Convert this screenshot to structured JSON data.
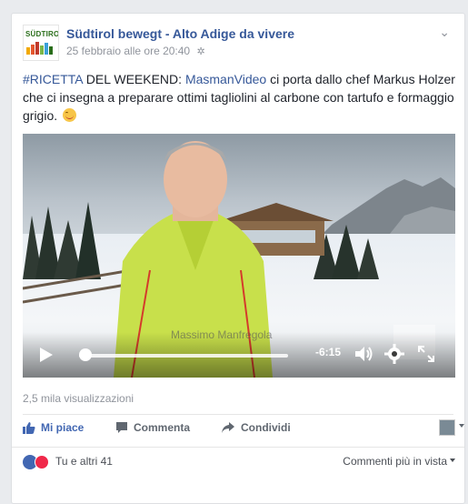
{
  "post": {
    "page_name": "Südtirol bewegt - Alto Adige da vivere",
    "timestamp": "25 febbraio alle ore 20:40",
    "privacy_icon": "gear-icon",
    "avatar_logo_text": "SÜDTIROL",
    "text": {
      "hashtag": "#RICETTA",
      "part1": " DEL WEEKEND: ",
      "mention": "MasmanVideo",
      "part2": " ci porta dallo chef Markus Holzer che ci insegna a preparare ottimi tagliolini al carbone con tartufo e formaggio grigio. "
    }
  },
  "video": {
    "time_remaining": "-6:15",
    "watermark": "Massimo Manfregola",
    "progress": 0.03
  },
  "stats": {
    "views": "2,5 mila visualizzazioni"
  },
  "actions": {
    "like": "Mi piace",
    "comment": "Commenta",
    "share": "Condividi"
  },
  "footer": {
    "reactions_text": "Tu e altri 41",
    "sort_label": "Commenti più in vista"
  },
  "colors": {
    "link": "#365899",
    "like_active": "#4267b2",
    "heart": "#f0284a"
  }
}
